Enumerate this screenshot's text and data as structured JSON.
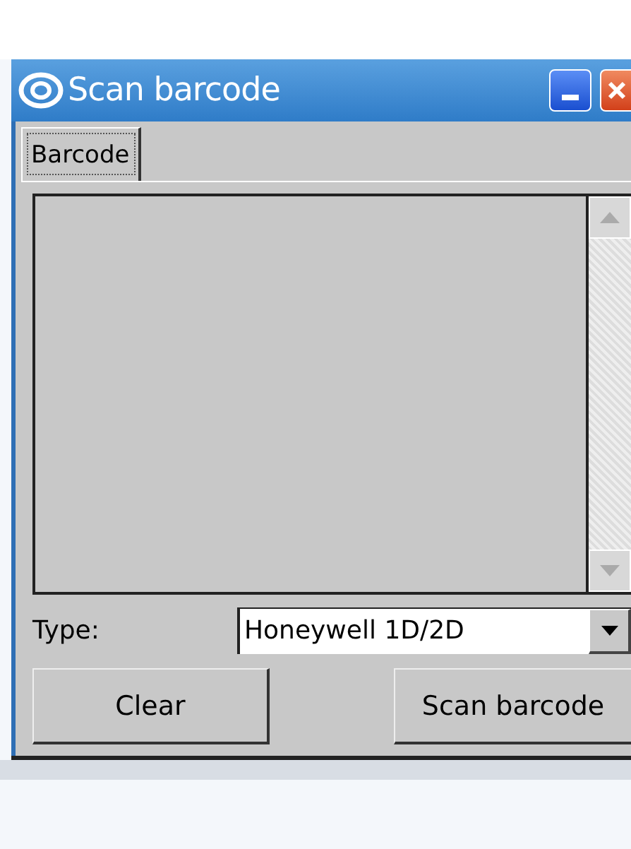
{
  "window": {
    "title": "Scan barcode"
  },
  "tabs": [
    {
      "label": "Barcode",
      "selected": true
    }
  ],
  "type_field": {
    "label": "Type:",
    "value": "Honeywell 1D/2D"
  },
  "buttons": [
    "Clear",
    "Scan barcode"
  ]
}
